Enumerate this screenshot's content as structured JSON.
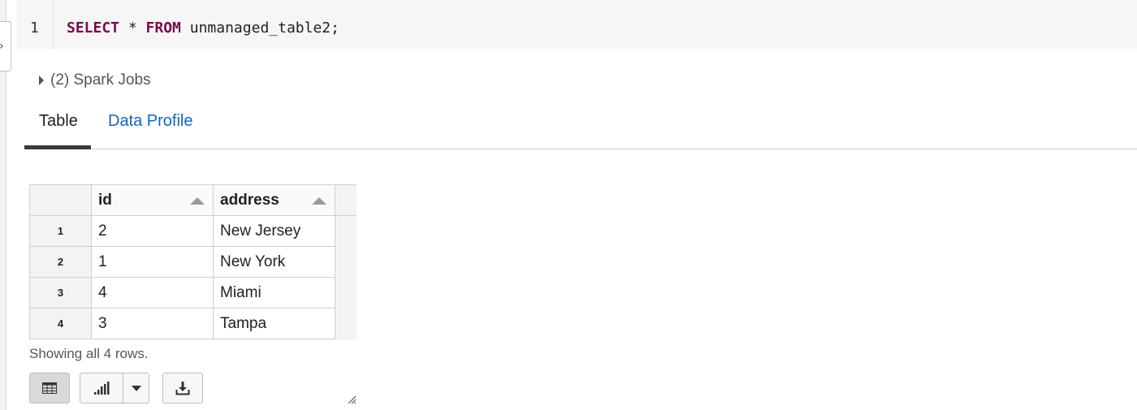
{
  "editor": {
    "line_number": "1",
    "keyword_select": "SELECT",
    "star": " * ",
    "keyword_from": "FROM",
    "rest": " unmanaged_table2;"
  },
  "spark_jobs": {
    "label": "(2) Spark Jobs"
  },
  "tabs": [
    {
      "label": "Table",
      "active": true
    },
    {
      "label": "Data Profile",
      "active": false
    }
  ],
  "table": {
    "columns": [
      "id",
      "address"
    ],
    "rows": [
      {
        "num": "1",
        "id": "2",
        "address": "New Jersey"
      },
      {
        "num": "2",
        "id": "1",
        "address": "New York"
      },
      {
        "num": "3",
        "id": "4",
        "address": "Miami"
      },
      {
        "num": "4",
        "id": "3",
        "address": "Tampa"
      }
    ]
  },
  "footer": {
    "rows_note": "Showing all 4 rows."
  },
  "toolbar": {
    "table_view_icon": "table-icon",
    "chart_icon": "bar-chart-icon",
    "chart_menu_icon": "chevron-down-icon",
    "download_icon": "download-icon"
  },
  "colors": {
    "keyword": "#7a0a4a",
    "link": "#1565c0",
    "active_tab_underline": "#3a3a3a"
  }
}
